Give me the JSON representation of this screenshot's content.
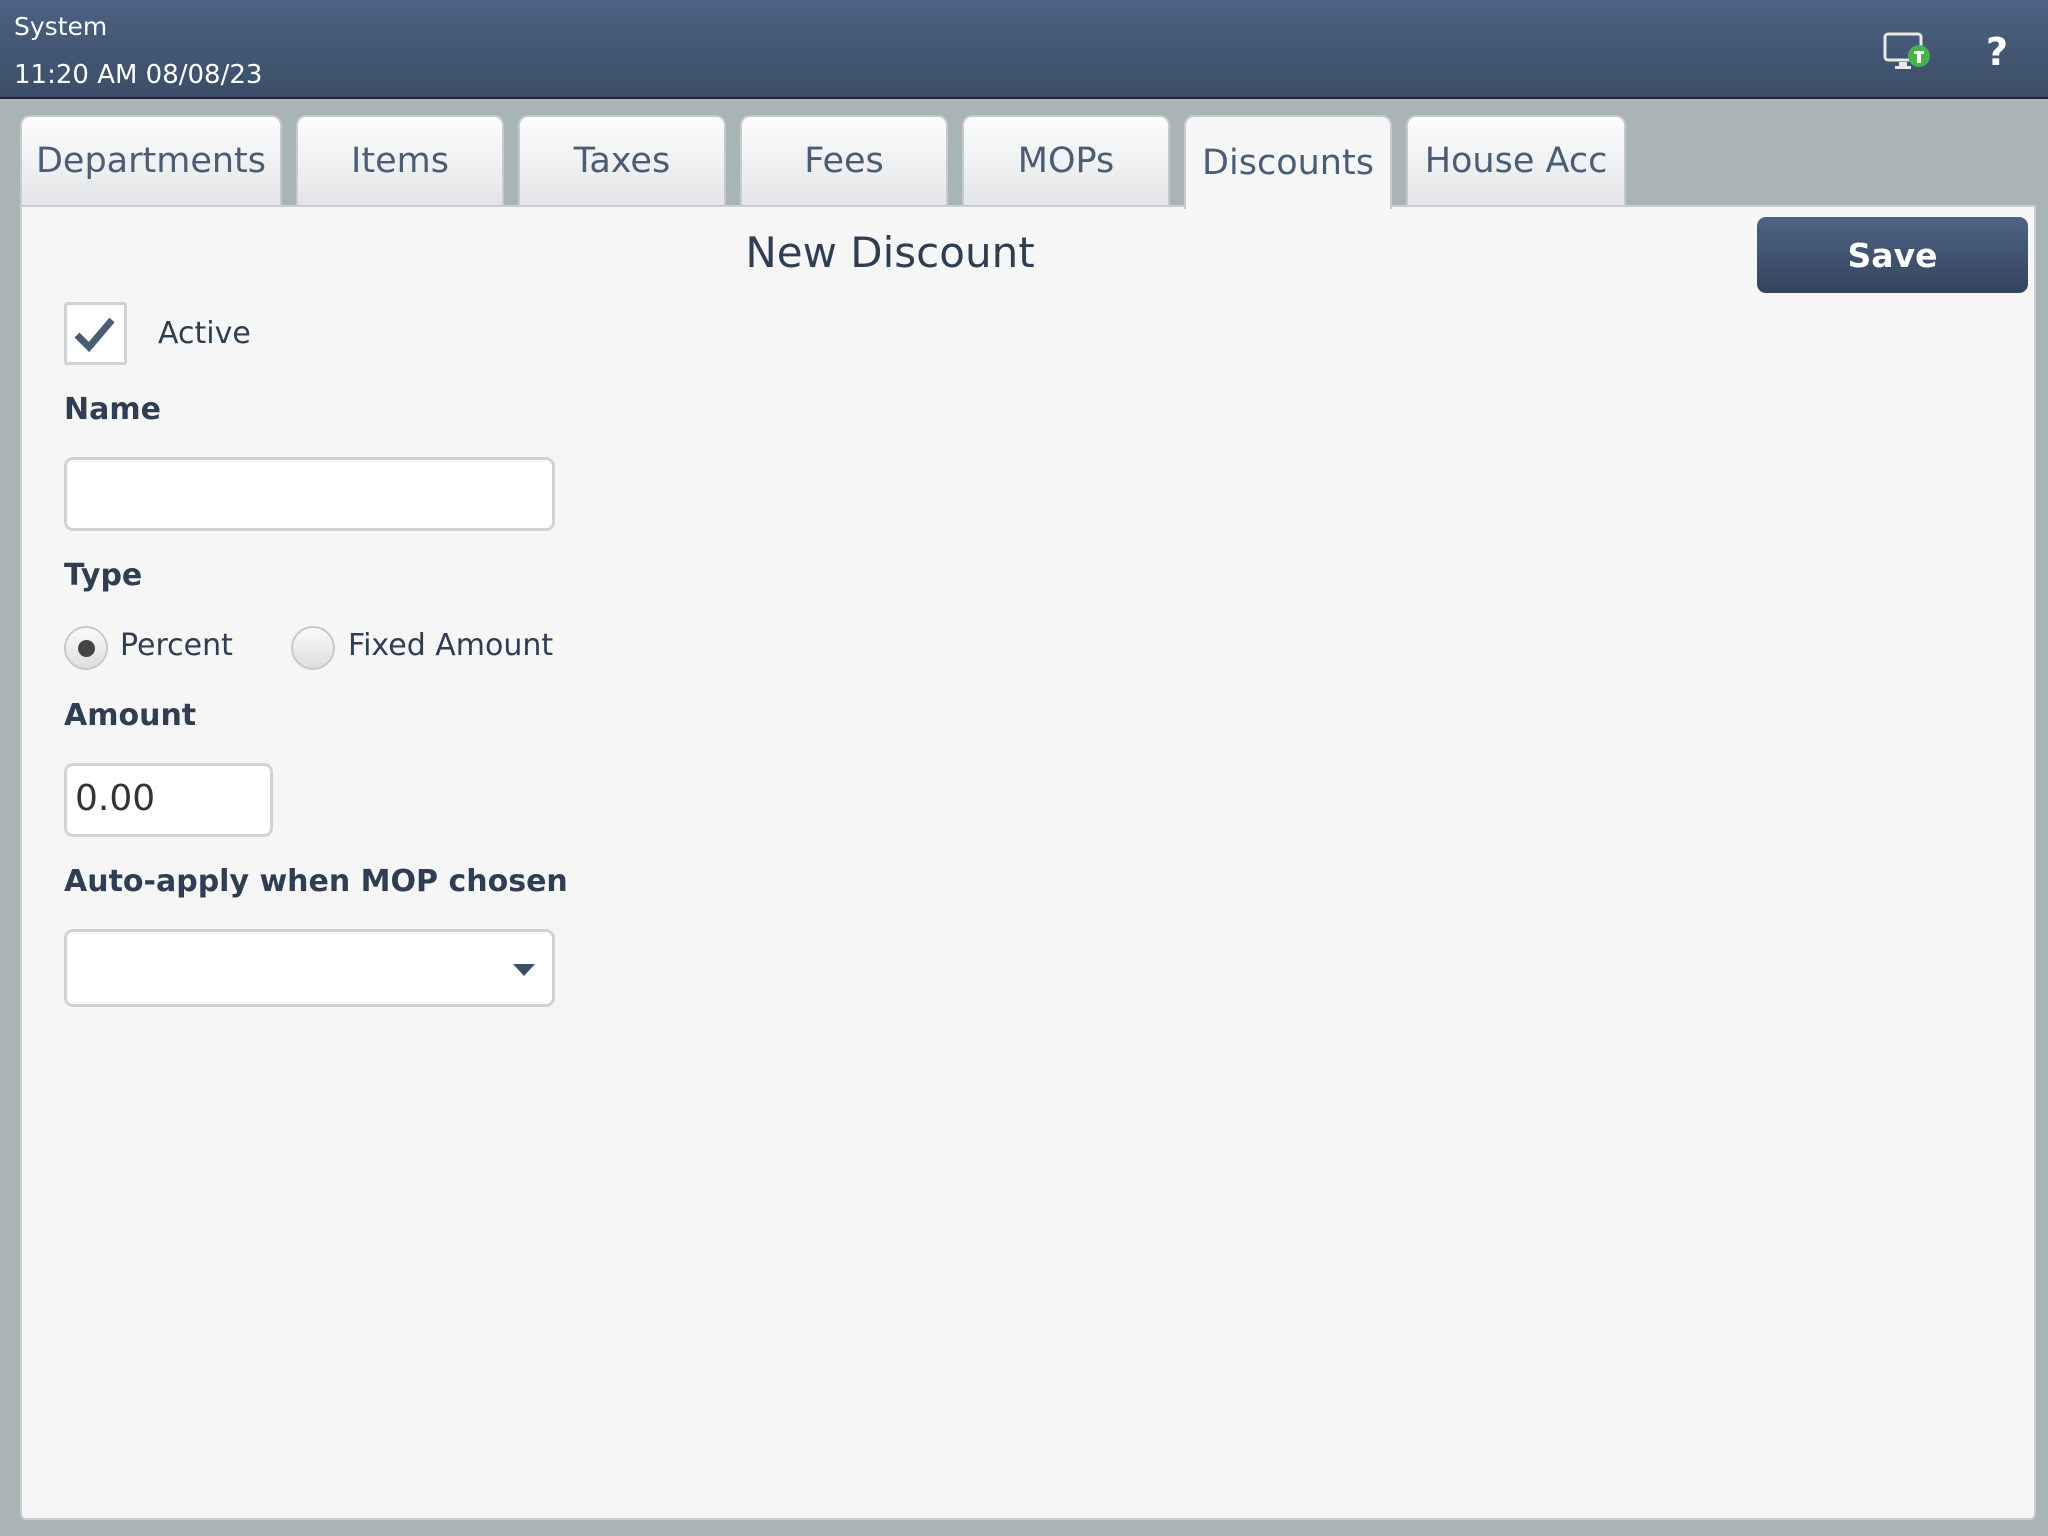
{
  "header": {
    "title": "System",
    "datetime": "11:20 AM 08/08/23"
  },
  "tabs": [
    {
      "label": "Departments"
    },
    {
      "label": "Items"
    },
    {
      "label": "Taxes"
    },
    {
      "label": "Fees"
    },
    {
      "label": "MOPs"
    },
    {
      "label": "Discounts"
    },
    {
      "label": "House Acc"
    }
  ],
  "form": {
    "title": "New Discount",
    "save_label": "Save",
    "active_label": "Active",
    "active_checked": true,
    "name_label": "Name",
    "name_value": "",
    "type_label": "Type",
    "type_options": [
      "Percent",
      "Fixed Amount"
    ],
    "type_selected": "Percent",
    "amount_label": "Amount",
    "amount_value": "0.00",
    "autoapply_label": "Auto-apply when MOP chosen",
    "autoapply_value": ""
  }
}
